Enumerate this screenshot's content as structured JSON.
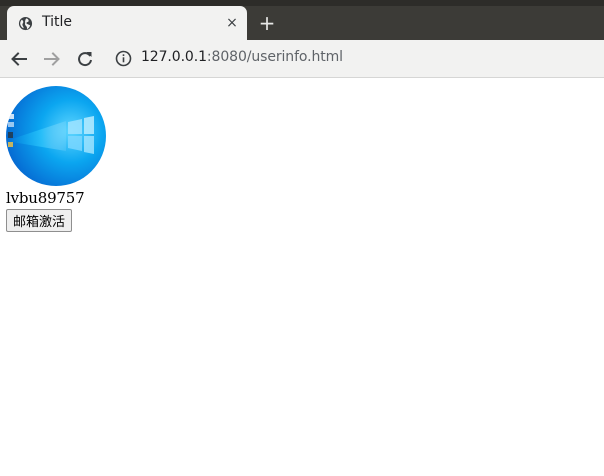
{
  "browser": {
    "tab": {
      "title": "Title",
      "close_glyph": "×",
      "favicon": "globe-icon"
    },
    "new_tab_glyph": "+",
    "address_bar": {
      "host": "127.0.0.1",
      "path": ":8080/userinfo.html",
      "security_icon": "info-icon"
    },
    "nav": {
      "back_icon": "arrow-left-icon",
      "forward_icon": "arrow-right-icon",
      "reload_icon": "reload-icon"
    }
  },
  "page": {
    "avatar_icon": "avatar",
    "username": "lvbu89757",
    "activate_email_button": "邮箱激活"
  },
  "colors": {
    "tabstrip": "#3c3b37",
    "toolbar": "#f2f2f1",
    "avatar_blue": "#0a8ce8"
  }
}
